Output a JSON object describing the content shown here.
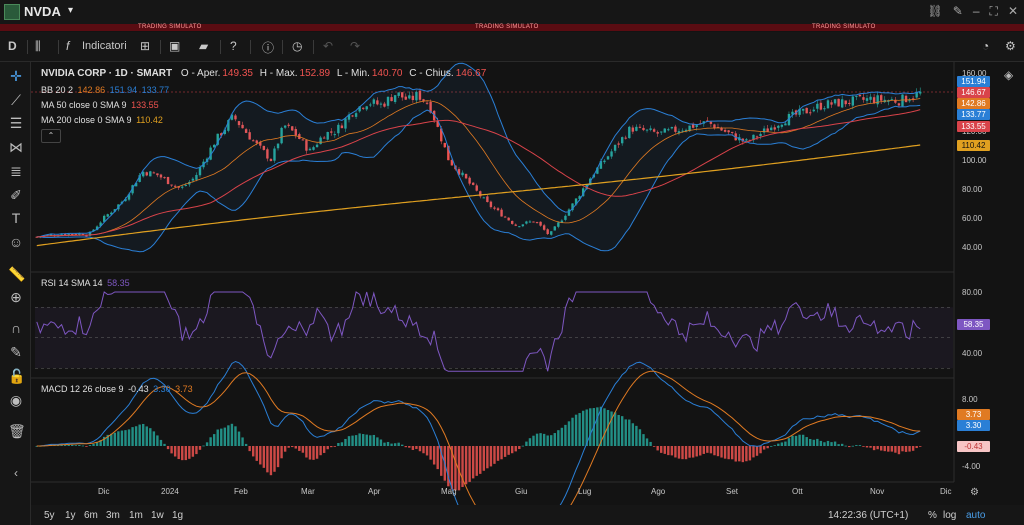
{
  "header": {
    "symbol": "NVDA",
    "caret": "▾",
    "sim_label": "TRADING SIMULATO",
    "sim_labels": [
      "TRADING SIMULATO",
      "TRADING SIMULATO",
      "TRADING SIMULATO"
    ]
  },
  "toolbar": {
    "interval": "D",
    "indicators_label": "Indicatori"
  },
  "main_legend": {
    "title": "NVIDIA CORP · 1D · SMART",
    "open_label": "O - Aper.",
    "open": "149.35",
    "high_label": "H - Max.",
    "high": "152.89",
    "low_label": "L - Min.",
    "low": "140.70",
    "close_label": "C - Chius.",
    "close": "146.67",
    "bb_label": "BB 20 2",
    "bb_mid": "142.86",
    "bb_up": "151.94",
    "bb_low": "133.77",
    "ma50_label": "MA 50 close 0 SMA 9",
    "ma50": "133.55",
    "ma200_label": "MA 200 close 0 SMA 9",
    "ma200": "110.42"
  },
  "rsi_legend": {
    "label": "RSI 14 SMA 14",
    "value": "58.35"
  },
  "macd_legend": {
    "label": "MACD 12 26 close 9",
    "hist": "-0.43",
    "macd": "3.30",
    "signal": "3.73"
  },
  "price_ticks": [
    "160.00",
    "120.00",
    "100.00",
    "80.00",
    "60.00",
    "40.00"
  ],
  "price_badges": [
    {
      "text": "151.94",
      "color": "#2a7fd6"
    },
    {
      "text": "146.67",
      "color": "#d9434a"
    },
    {
      "text": "142.86",
      "color": "#e07a22"
    },
    {
      "text": "133.77",
      "color": "#2a7fd6"
    },
    {
      "text": "133.55",
      "color": "#d9434a"
    },
    {
      "text": "110.42",
      "color": "#e0a020"
    }
  ],
  "rsi_ticks": [
    "80.00",
    "40.00"
  ],
  "rsi_badge": {
    "text": "58.35",
    "color": "#7e57c2"
  },
  "macd_ticks": [
    "8.00",
    "-4.00"
  ],
  "macd_badges": [
    {
      "text": "3.73",
      "color": "#e07a22"
    },
    {
      "text": "3.30",
      "color": "#2a7fd6"
    },
    {
      "text": "-0.43",
      "color": "#f7c5c5"
    }
  ],
  "time_labels": [
    "Dic",
    "2024",
    "Feb",
    "Mar",
    "Apr",
    "Mag",
    "Giu",
    "Lug",
    "Ago",
    "Set",
    "Ott",
    "Nov",
    "Dic"
  ],
  "ranges": [
    "5y",
    "1y",
    "6m",
    "3m",
    "1m",
    "1w",
    "1g"
  ],
  "clock": "14:22:36 (UTC+1)",
  "bottom_right": [
    "%",
    "log",
    "auto"
  ],
  "colors": {
    "bull": "#26a69a",
    "bear": "#ef5350",
    "bb": "#2a7fd6",
    "ma50": "#e07a22",
    "ma200": "#e0a020",
    "rsi": "#7e57c2",
    "macd": "#2a7fd6",
    "signal": "#e07a22"
  },
  "icons": {
    "crosshair": "crosshair-icon",
    "trendline": "trendline-icon",
    "fib": "fib-icon",
    "pattern": "pattern-icon",
    "brush": "brush-icon",
    "text": "text-icon",
    "emoji": "emoji-icon",
    "ruler": "ruler-icon",
    "zoom": "zoom-icon",
    "magnet": "magnet-icon",
    "lock": "lock-icon",
    "eye": "eye-icon",
    "trash": "trash-icon"
  }
}
